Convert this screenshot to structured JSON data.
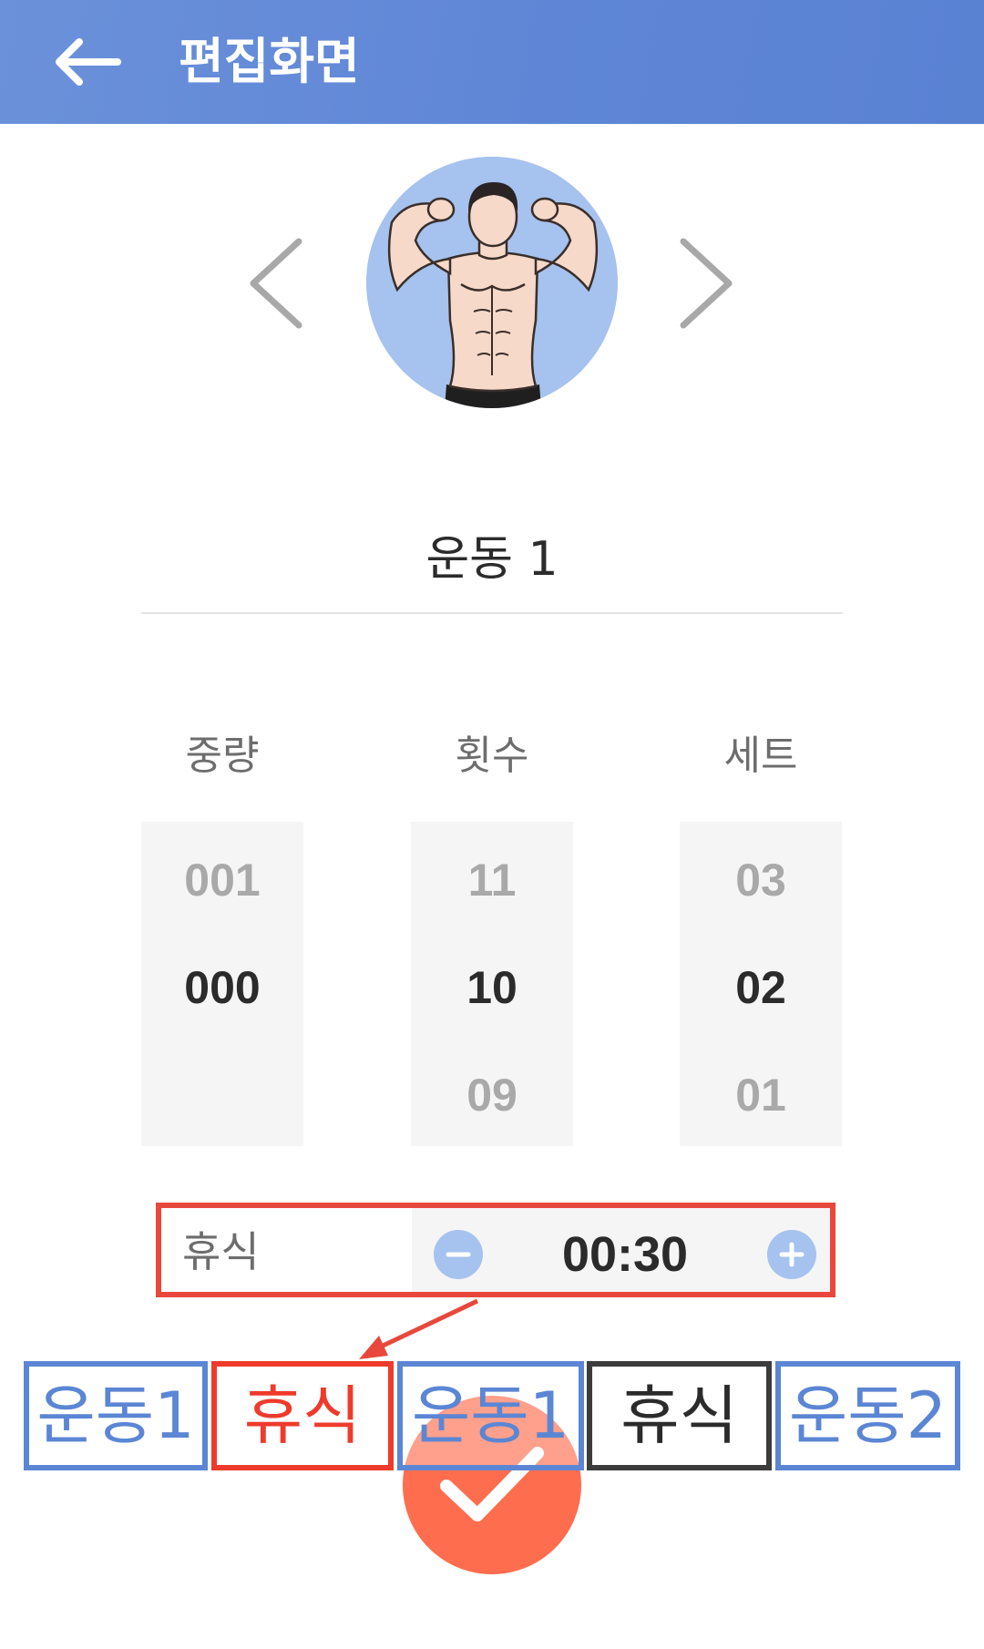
{
  "app_bar": {
    "title": "편집화면",
    "back_icon": "arrow-left-icon",
    "color": "#5f86d6"
  },
  "carousel": {
    "prev_icon": "chevron-left-icon",
    "next_icon": "chevron-right-icon",
    "image": "flexing-man-illustration"
  },
  "exercise": {
    "name": "운동 1"
  },
  "pickers": [
    {
      "label": "중량",
      "above": "001",
      "selected": "000",
      "below": ""
    },
    {
      "label": "횟수",
      "above": "11",
      "selected": "10",
      "below": "09"
    },
    {
      "label": "세트",
      "above": "03",
      "selected": "02",
      "below": "01"
    }
  ],
  "rest": {
    "label": "휴식",
    "value": "00:30",
    "minus_icon": "minus-circle-icon",
    "plus_icon": "plus-circle-icon",
    "highlight_color": "#e8483c"
  },
  "sequence": [
    {
      "label": "운동1",
      "kind": "exercise"
    },
    {
      "label": "휴식",
      "kind": "rest-highlighted"
    },
    {
      "label": "운동1",
      "kind": "exercise"
    },
    {
      "label": "휴식",
      "kind": "rest"
    },
    {
      "label": "운동2",
      "kind": "exercise"
    }
  ],
  "confirm": {
    "icon": "check-icon",
    "color": "#ff6d4f"
  }
}
